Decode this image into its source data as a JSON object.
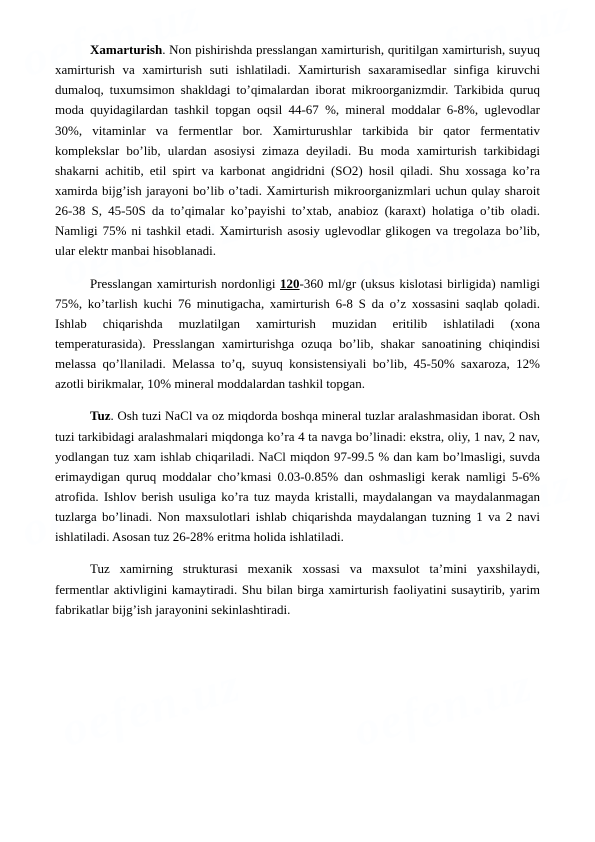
{
  "watermarks": [
    "oefen.uz",
    "oefen.uz",
    "oefen.uz",
    "oefen.uz",
    "oefen.uz",
    "oefen.uz"
  ],
  "paragraphs": [
    {
      "id": "xamarturish",
      "text_parts": [
        {
          "text": "Xamarturish",
          "bold": true
        },
        {
          "text": ". Non pishirishda presslangan xamirturish, quritilgan xamirturish, suyuq xamirturish va xamirturish suti ishlatiladi. Xamirturish saxaramisedlar sinfiga kiruvchi dumaloq, tuxumsimon shakldagi toʿqimalardan iborat mikroorganizmdir. Tarkibida quruq moda quyidagilardan tashkil topgan oqsil 44-67 %, mineral moddalar 6-8%, uglevodlar 30%, vitaminlar va fermentlar bor. Xamirturushlar tarkibida bir qator fermentativ komplekslar bo˻lib, ulardan asosiysi zimaza deyiladi. Bu moda xamirturish tarkibidagi shakarni achitib, etil spirt va karbonat angidridni (SO2) hosil qiladi. Shu xossaga ko˻ra xamirda bijg˻ish jarayoni bo˻lib o˻tadi. Xamirturish mikroorganizmlari uchun qulay sharoit 26-38 S, 45-50S da to˻qimalar ko˻payishi to˻xtab, anabioz (karaxt) holatiga o˻tib oladi. Namligi 75% ni tashkil etadi. Xamirturish asosiy uglevodlar glikogen va tregolaza bo˻lib, ular elektr manbai hisoblanadi.",
          "bold": false
        }
      ]
    },
    {
      "id": "presslangan",
      "text_parts": [
        {
          "text": "Presslangan xamirturish nordonligi ",
          "bold": false
        },
        {
          "text": "120",
          "bold": true,
          "underline": true
        },
        {
          "text": "-360 ml/gr (uksus kislotasi birligida) namligi 75%, ko˻tar lish kuchi 76 minutigacha, xamirturish 6-8 S da o˻z xossasini saqlab qoladi. Ishlab chiqarishda muzlatilgan xamirturish muzidan eritilib ishlatiladi (xona temperaturasida). Presslangan xamirturishga ozuqa bo˻lib, shakar sanoatining chiqindisi melassa qo˻llaniladi. Melassa to˻q, suyuq konsistensiyali bo˻lib, 45-50% saxaroza, 12% azotli birikmalar, 10% mineral moddalardan tashkil topgan.",
          "bold": false
        }
      ]
    },
    {
      "id": "tuz",
      "text_parts": [
        {
          "text": "Tuz",
          "bold": true
        },
        {
          "text": ". Osh tuzi NaCl va oz miqdorda boshqa mineral tuzlar aralashmasidan iborat. Osh tuzi tarkibidagi aralashmalari miqdonga ko˻ra 4 ta navga bo˻linadi: ekstra, oliy, 1 nav, 2 nav, yodlangan tuz xam ishlab chiqariladi. NaCl miqdon 97-99.5 % dan kam bo˻lmasligi, suvda erimaydigan quruq moddalar cho˻kmasi 0.03-0.85% dan oshmasligi kerak namligi 5-6% atrofida. Ishlov berish usuliga ko˻ra tuz mayda kristalli, maydalangan va maydalanmagan tuzlarga bo˻linadi. Non maxsulotlari ishlab chiqarishda maydalangan tuzning 1 va 2 navi ishlatiladi. Asosan tuz 26-28% eritma holida ishlatiladi.",
          "bold": false
        }
      ]
    },
    {
      "id": "tuz-xamir",
      "text_parts": [
        {
          "text": "Tuz xamirning strukturasi mexanik xossasi va maxsulot ta˻mini yaxshilaydi, fermentlar aktivligini kamaytiradi. Shu bilan birga xamirturish faoliyatini susaytirib, yarim fabrikatlar bijg˻ish jarayonini sekinlashtiradi.",
          "bold": false
        }
      ]
    }
  ]
}
